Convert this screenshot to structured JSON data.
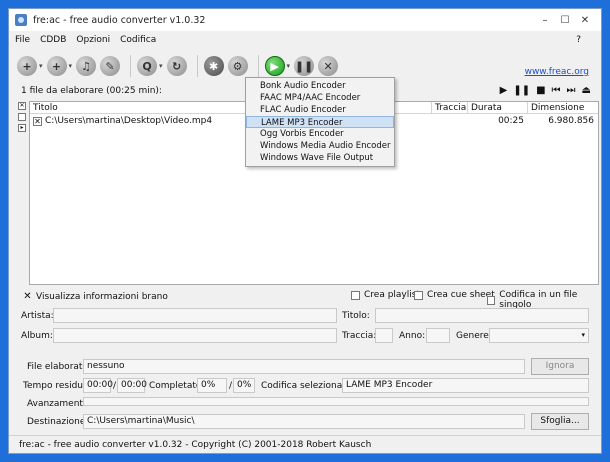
{
  "window": {
    "title": "fre:ac - free audio converter v1.0.32"
  },
  "menu": {
    "items": [
      "File",
      "CDDB",
      "Opzioni",
      "Codifica"
    ],
    "help": "?"
  },
  "toolbar": {
    "link": "www.freac.org"
  },
  "filelist": {
    "count_text": "1 file da elaborare (00:25 min):",
    "columns": [
      "Titolo",
      "Traccia",
      "Durata",
      "Dimensione"
    ],
    "rows": [
      {
        "title": "C:\\Users\\martina\\Desktop\\Video.mp4",
        "track": "",
        "duration": "00:25",
        "size": "6.980.856"
      }
    ]
  },
  "encoder_menu": {
    "items": [
      "Bonk Audio Encoder",
      "FAAC MP4/AAC Encoder",
      "FLAC Audio Encoder",
      "LAME MP3 Encoder",
      "Ogg Vorbis Encoder",
      "Windows Media Audio Encoder",
      "Windows Wave File Output"
    ],
    "selected": "LAME MP3 Encoder"
  },
  "options": {
    "playlist": "Crea playlist",
    "cuesheet": "Crea cue sheet",
    "single_file": "Codifica in un file singolo",
    "show_info": "Visualizza informazioni brano"
  },
  "info": {
    "artist_label": "Artista:",
    "title_label": "Titolo:",
    "album_label": "Album:",
    "track_label": "Traccia:",
    "year_label": "Anno:",
    "genre_label": "Genere:"
  },
  "progress": {
    "file_label": "File elaborato:",
    "file_value": "nessuno",
    "skip_button": "Ignora",
    "remaining_label": "Tempo residuo:",
    "remaining_1": "00:00",
    "remaining_sep": "/",
    "remaining_2": "00:00",
    "completed_label": "Completato:",
    "completed_1": "0%",
    "completed_sep": "/",
    "completed_2": "0%",
    "encoder_label": "Codifica selezionata:",
    "encoder_value": "LAME MP3 Encoder",
    "progress_label": "Avanzamento:",
    "dest_label": "Destinazione:",
    "dest_value": "C:\\Users\\martina\\Music\\",
    "browse_button": "Sfoglia..."
  },
  "statusbar": {
    "text": "fre:ac - free audio converter v1.0.32 - Copyright (C) 2001-2018 Robert Kausch"
  }
}
